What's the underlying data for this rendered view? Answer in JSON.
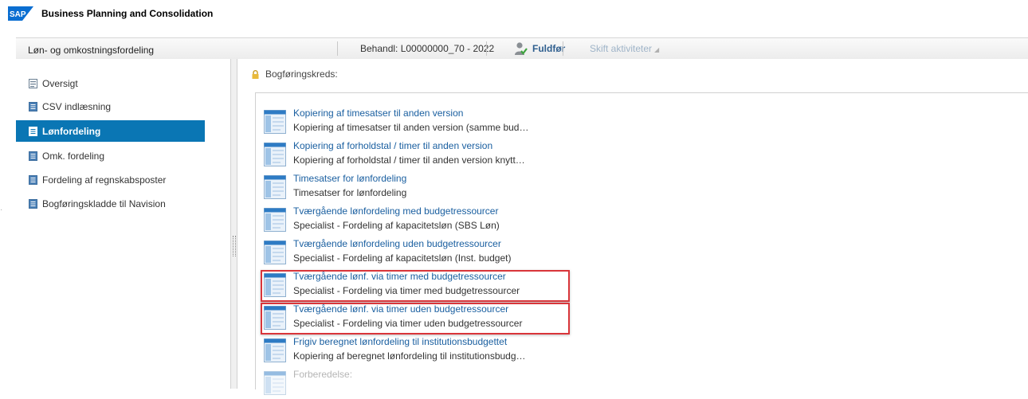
{
  "app": {
    "logo_text": "SAP",
    "title": "Business Planning and Consolidation"
  },
  "header": {
    "title": "Løn- og omkostningsfordeling",
    "behandl": "Behandl:  L00000000_70 - 2022",
    "finish_label": "Fuldfør",
    "switch_label": "Skift aktiviteter"
  },
  "sidebar": {
    "items": [
      {
        "label": "Oversigt",
        "icon": "overview-icon",
        "active": false
      },
      {
        "label": "CSV indlæsning",
        "icon": "document-icon",
        "active": false
      },
      {
        "label": "Lønfordeling",
        "icon": "document-icon",
        "active": true
      },
      {
        "label": "Omk. fordeling",
        "icon": "document-icon",
        "active": false
      },
      {
        "label": "Fordeling af regnskabsposter",
        "icon": "document-icon",
        "active": false
      },
      {
        "label": "Bogføringskladde til Navision",
        "icon": "document-icon",
        "active": false
      }
    ]
  },
  "main": {
    "company_label": "Bogføringskreds:",
    "tasks": [
      {
        "title": "Kopiering af timesatser til anden version",
        "desc": "Kopiering af timesatser til anden version (samme bud…"
      },
      {
        "title": "Kopiering af forholdstal / timer til anden version",
        "desc": "Kopiering af forholdstal / timer til anden version knytt…"
      },
      {
        "title": "Timesatser for lønfordeling",
        "desc": "Timesatser for lønfordeling"
      },
      {
        "title": "Tværgående lønfordeling med budgetressourcer",
        "desc": "Specialist - Fordeling af kapacitetsløn (SBS Løn)"
      },
      {
        "title": "Tværgående lønfordeling uden budgetressourcer",
        "desc": "Specialist - Fordeling af kapacitetsløn (Inst. budget)"
      },
      {
        "title": "Tværgående lønf. via timer med budgetressourcer",
        "desc": "Specialist - Fordeling via timer med budgetressourcer",
        "highlighted": true
      },
      {
        "title": "Tværgående lønf. via timer uden budgetressourcer",
        "desc": "Specialist - Fordeling via timer uden budgetressourcer",
        "highlighted": true
      },
      {
        "title": "Frigiv beregnet lønfordeling til institutionsbudgettet",
        "desc": "Kopiering af beregnet lønfordeling til institutionsbudg…"
      },
      {
        "title": "Forberedelse:",
        "desc": "",
        "disabled": true
      }
    ]
  },
  "colors": {
    "accent": "#0a76b4",
    "link": "#1a5fa0",
    "highlight": "#d9353a",
    "sap_blue": "#0a6ed1"
  }
}
